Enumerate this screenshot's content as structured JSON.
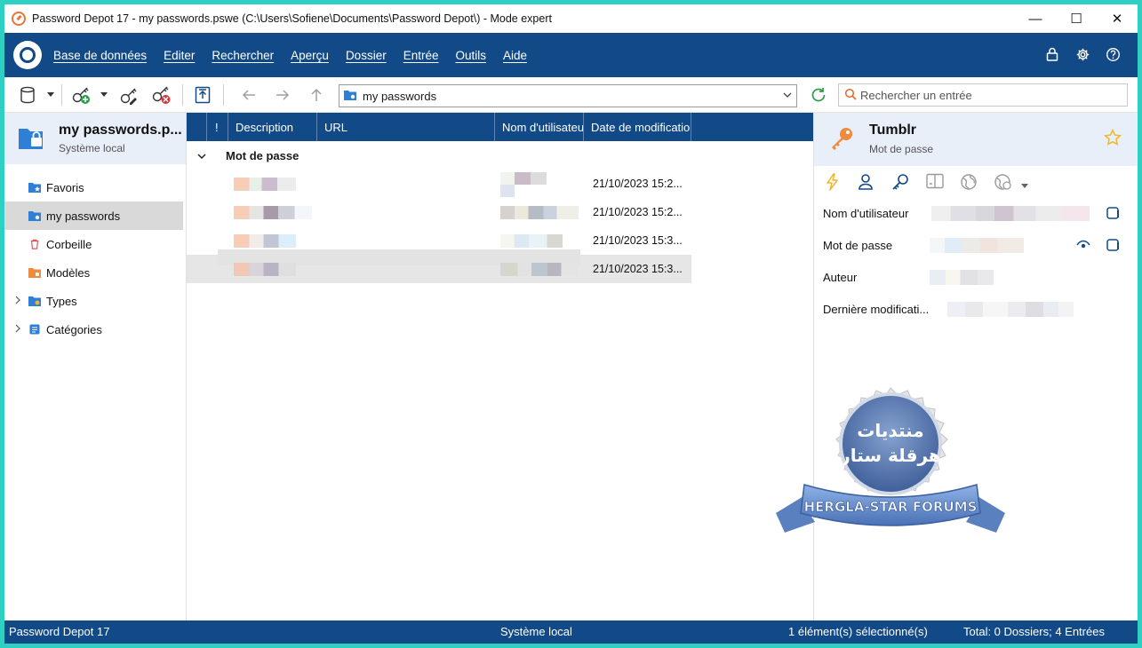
{
  "window": {
    "title": "Password Depot 17  - my passwords.pswe (C:\\Users\\Sofiene\\Documents\\Password Depot\\) - Mode expert",
    "minimize": "—",
    "maximize": "☐",
    "close": "✕"
  },
  "menu": {
    "items": [
      "Base de données",
      "Editer",
      "Rechercher",
      "Aperçu",
      "Dossier",
      "Entrée",
      "Outils",
      "Aide"
    ]
  },
  "toolbar": {
    "path": "my passwords",
    "search_placeholder": "Rechercher un entrée"
  },
  "database": {
    "name": "my passwords.p...",
    "location": "Système local"
  },
  "tree": {
    "items": [
      {
        "label": "Favoris",
        "icon": "folder-star-icon",
        "color": "#2f7fd6"
      },
      {
        "label": "my passwords",
        "icon": "folder-user-icon",
        "color": "#2f7fd6"
      },
      {
        "label": "Corbeille",
        "icon": "trash-icon",
        "color": "#e04a4a"
      },
      {
        "label": "Modèles",
        "icon": "folder-templates-icon",
        "color": "#f08a3c"
      },
      {
        "label": "Types",
        "icon": "folder-types-icon",
        "color": "#2f7fd6"
      },
      {
        "label": "Catégories",
        "icon": "categories-icon",
        "color": "#2f7fd6"
      }
    ]
  },
  "grid": {
    "columns": [
      "!",
      "Description",
      "URL",
      "Nom d'utilisateur",
      "Date de modification"
    ],
    "group_label": "Mot de passe",
    "rows": [
      {
        "date": "21/10/2023 15:2..."
      },
      {
        "date": "21/10/2023 15:2..."
      },
      {
        "date": "21/10/2023 15:3..."
      },
      {
        "date": "21/10/2023 15:3..."
      }
    ]
  },
  "details": {
    "title": "Tumblr",
    "type": "Mot de passe",
    "fields": [
      {
        "label": "Nom d'utilisateur"
      },
      {
        "label": "Mot de passe"
      },
      {
        "label": "Auteur"
      },
      {
        "label": "Dernière modificati..."
      }
    ]
  },
  "watermark": {
    "arabic_line1": "منتديات",
    "arabic_line2": "هرقلة ستار",
    "ribbon": "HERGLA-STAR FORUMS"
  },
  "status": {
    "app": "Password Depot 17",
    "location": "Système local",
    "selection": "1 élément(s) sélectionné(s)",
    "total": "Total: 0 Dossiers; 4 Entrées"
  },
  "colors": {
    "brand_blue": "#124a87",
    "accent_orange": "#f08a3c",
    "star_yellow": "#f2b724"
  }
}
